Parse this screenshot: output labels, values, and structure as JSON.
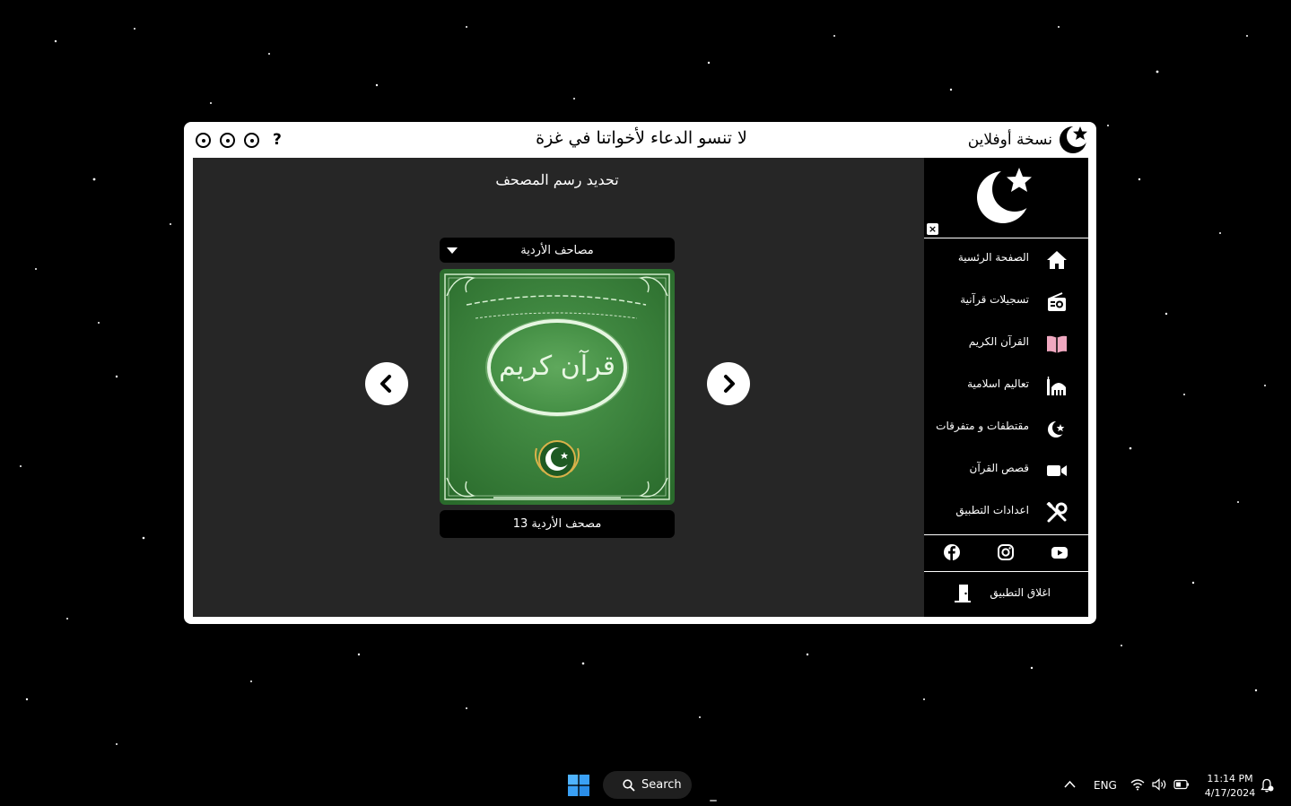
{
  "titlebar": {
    "help": "?",
    "banner": "لا تنسو الدعاء لأخواتنا في غزة",
    "app_name": "نسخة أوفلاين"
  },
  "content": {
    "page_title": "تحديد رسم المصحف",
    "dropdown_selected": "مصاحف الأردية",
    "cover_caption": "مصحف الأردية 13",
    "cover_inscription": "قرآن كريم"
  },
  "sidebar": {
    "close": "×",
    "items": [
      {
        "label": "الصفحة الرئسية",
        "icon": "home-icon"
      },
      {
        "label": "تسجيلات قرآنية",
        "icon": "radio-icon"
      },
      {
        "label": "القرآن الكريم",
        "icon": "book-icon"
      },
      {
        "label": "تعاليم اسلامية",
        "icon": "mosque-icon"
      },
      {
        "label": "مقتطفات و متفرقات",
        "icon": "crescent-star-icon"
      },
      {
        "label": "قصص القرآن",
        "icon": "video-icon"
      },
      {
        "label": "اعدادات التطبيق",
        "icon": "tools-icon"
      }
    ],
    "social": [
      "facebook-icon",
      "instagram-icon",
      "youtube-icon"
    ],
    "exit_label": "اغلاق التطبيق"
  },
  "taskbar": {
    "search": "Search",
    "lang": "ENG",
    "time": "11:14 PM",
    "date": "4/17/2024"
  },
  "colors": {
    "content_bg": "#262626",
    "sidebar_bg": "#000000",
    "cover_green": "#2f7a34",
    "book_icon": "#f0a8c0"
  }
}
